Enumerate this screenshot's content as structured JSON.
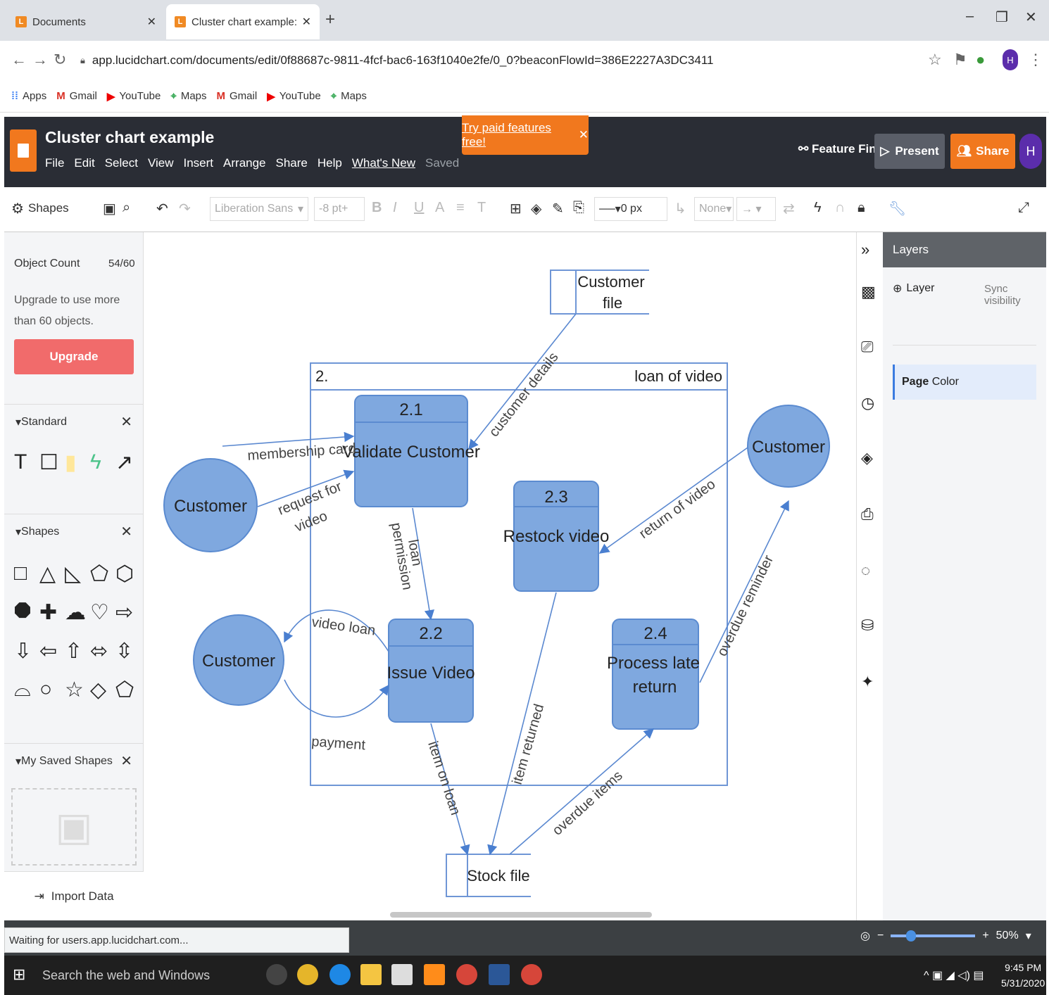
{
  "browser": {
    "tabs": [
      {
        "title": "Documents",
        "active": false
      },
      {
        "title": "Cluster chart example: Lucidchart",
        "active": true
      }
    ],
    "url": "app.lucidchart.com/documents/edit/0f88687c-9811-4fcf-bac6-163f1040e2fe/0_0?beaconFlowId=386E2227A3DC3411",
    "bookmarks": [
      "Apps",
      "Gmail",
      "YouTube",
      "Maps",
      "Gmail",
      "YouTube",
      "Maps"
    ],
    "profile_initial": "H"
  },
  "lucid": {
    "doc_title": "Cluster chart example",
    "menu": [
      "File",
      "Edit",
      "Select",
      "View",
      "Insert",
      "Arrange",
      "Share",
      "Help",
      "What's New",
      "Saved"
    ],
    "try_paid": "Try paid features free!",
    "feature_find": "Feature Find",
    "present": "Present",
    "share": "Share",
    "avatar": "H"
  },
  "toolbar": {
    "shapes_label": "Shapes",
    "font": "Liberation Sans",
    "font_size": "8 pt",
    "line_width": "0 px",
    "arrow_none": "None"
  },
  "left_panel": {
    "object_count_label": "Object Count",
    "object_count_value": "54/60",
    "upgrade_text": "Upgrade to use more than 60 objects.",
    "upgrade_button": "Upgrade",
    "sections": [
      "Standard",
      "Shapes",
      "My Saved Shapes"
    ],
    "import_data": "Import Data"
  },
  "right_panel": {
    "title": "Layers",
    "add_layer": "Layer",
    "sync": "Sync visibility",
    "page": "Page",
    "color": "Color"
  },
  "diagram": {
    "customer_file": [
      "Customer",
      "file"
    ],
    "group_number": "2.",
    "group_title": "loan of video",
    "p21_num": "2.1",
    "p21_label": "Validate Customer",
    "p22_num": "2.2",
    "p22_label": "Issue Video",
    "p23_num": "2.3",
    "p23_label": "Restock video",
    "p24_num": "2.4",
    "p24_label": [
      "Process late",
      "return"
    ],
    "customer": "Customer",
    "stock_file": "Stock file",
    "flows": {
      "membership": "membership card",
      "request": [
        "request for",
        "video"
      ],
      "customer_details": "customer details",
      "loan_permission": [
        "loan",
        "permission"
      ],
      "video_loan": "video loan",
      "payment": "payment",
      "return_of_video": "return of video",
      "overdue_reminder": "overdue reminder",
      "item_returned": "item returned",
      "item_on_loan": "item on loan",
      "overdue_items": "overdue items"
    }
  },
  "status": {
    "waiting": "Waiting for users.app.lucidchart.com...",
    "zoom": "50%"
  },
  "taskbar": {
    "search": "Search the web and Windows",
    "time": "9:45 PM",
    "date": "5/31/2020"
  },
  "colors": {
    "shape_fill": "#7fa8df",
    "shape_stroke": "#5b8bd0",
    "orange": "#f1781e",
    "header_dark": "#2a2d35"
  }
}
